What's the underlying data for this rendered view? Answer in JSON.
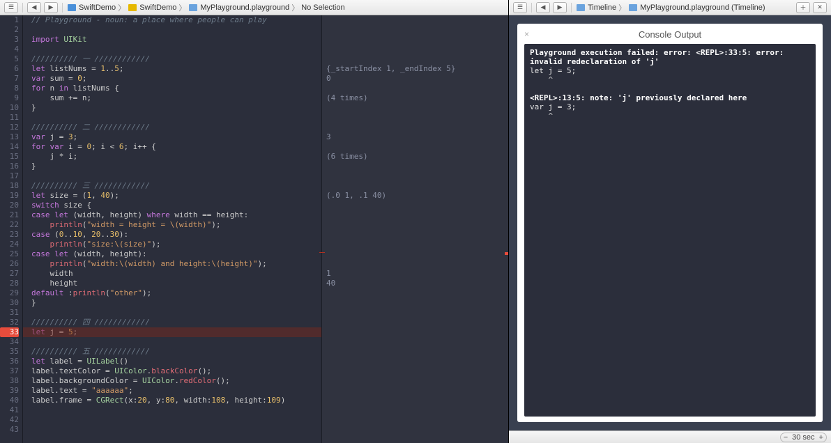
{
  "toolbar_left": {
    "crumbs": [
      {
        "icon": "swift",
        "label": "SwiftDemo"
      },
      {
        "icon": "folder",
        "label": "SwiftDemo"
      },
      {
        "icon": "playground",
        "label": "MyPlayground.playground"
      },
      {
        "icon": "",
        "label": "No Selection"
      }
    ]
  },
  "toolbar_right": {
    "crumbs": [
      {
        "icon": "timeline",
        "label": "Timeline"
      },
      {
        "icon": "playground",
        "label": "MyPlayground.playground (Timeline)"
      }
    ]
  },
  "code_lines": [
    {
      "n": 1,
      "html": "<span class='c-comment'>// Playground - noun: a place where people can play</span>"
    },
    {
      "n": 2,
      "html": ""
    },
    {
      "n": 3,
      "html": "<span class='c-kw'>import</span> <span class='c-type'>UIKit</span>"
    },
    {
      "n": 4,
      "html": ""
    },
    {
      "n": 5,
      "html": "<span class='c-comment'>////////// 一 ////////////</span>"
    },
    {
      "n": 6,
      "html": "<span class='c-kw'>let</span> listNums = <span class='c-num'>1</span>..<span class='c-num'>5</span>;"
    },
    {
      "n": 7,
      "html": "<span class='c-kw'>var</span> sum = <span class='c-num'>0</span>;"
    },
    {
      "n": 8,
      "html": "<span class='c-kw'>for</span> n <span class='c-kw'>in</span> listNums {"
    },
    {
      "n": 9,
      "html": "    sum += n;"
    },
    {
      "n": 10,
      "html": "}"
    },
    {
      "n": 11,
      "html": ""
    },
    {
      "n": 12,
      "html": "<span class='c-comment'>////////// 二 ////////////</span>"
    },
    {
      "n": 13,
      "html": "<span class='c-kw'>var</span> j = <span class='c-num'>3</span>;"
    },
    {
      "n": 14,
      "html": "<span class='c-kw'>for</span> <span class='c-kw'>var</span> i = <span class='c-num'>0</span>; i &lt; <span class='c-num'>6</span>; i++ {"
    },
    {
      "n": 15,
      "html": "    j * i;"
    },
    {
      "n": 16,
      "html": "}"
    },
    {
      "n": 17,
      "html": ""
    },
    {
      "n": 18,
      "html": "<span class='c-comment'>////////// 三 ////////////</span>"
    },
    {
      "n": 19,
      "html": "<span class='c-kw'>let</span> size = (<span class='c-num'>1</span>, <span class='c-num'>40</span>);"
    },
    {
      "n": 20,
      "html": "<span class='c-kw'>switch</span> size {"
    },
    {
      "n": 21,
      "html": "<span class='c-kw'>case</span> <span class='c-kw'>let</span> (width, height) <span class='c-kw'>where</span> width == height:"
    },
    {
      "n": 22,
      "html": "    <span class='c-func'>println</span>(<span class='c-str'>\"width = height = \\(width)\"</span>);"
    },
    {
      "n": 23,
      "html": "<span class='c-kw'>case</span> (<span class='c-num'>0</span>..<span class='c-num'>10</span>, <span class='c-num'>20</span>..<span class='c-num'>30</span>):"
    },
    {
      "n": 24,
      "html": "    <span class='c-func'>println</span>(<span class='c-str'>\"size:\\(size)\"</span>);"
    },
    {
      "n": 25,
      "html": "<span class='c-kw'>case</span> <span class='c-kw'>let</span> (width, height):"
    },
    {
      "n": 26,
      "html": "    <span class='c-func'>println</span>(<span class='c-str'>\"width:\\(width) and height:\\(height)\"</span>);"
    },
    {
      "n": 27,
      "html": "    width"
    },
    {
      "n": 28,
      "html": "    height"
    },
    {
      "n": 29,
      "html": "<span class='c-kw'>default</span> :<span class='c-func'>println</span>(<span class='c-str'>\"other\"</span>);"
    },
    {
      "n": 30,
      "html": "}"
    },
    {
      "n": 31,
      "html": ""
    },
    {
      "n": 32,
      "html": "<span class='c-comment'>////////// 四 ////////////</span>"
    },
    {
      "n": 33,
      "html": "<span class='c-kw'>let</span> j = <span class='c-num'>5</span>;",
      "error": true,
      "error_msg": "Invalid redeclaration of 'j'"
    },
    {
      "n": 34,
      "html": ""
    },
    {
      "n": 35,
      "html": "<span class='c-comment'>////////// 五 ////////////</span>"
    },
    {
      "n": 36,
      "html": "<span class='c-kw'>let</span> label = <span class='c-type'>UILabel</span>()"
    },
    {
      "n": 37,
      "html": "label.textColor = <span class='c-type'>UIColor</span>.<span class='c-func'>blackColor</span>();"
    },
    {
      "n": 38,
      "html": "label.backgroundColor = <span class='c-type'>UIColor</span>.<span class='c-func'>redColor</span>();"
    },
    {
      "n": 39,
      "html": "label.text = <span class='c-str'>\"aaaaaa\"</span>;"
    },
    {
      "n": 40,
      "html": "label.frame = <span class='c-type'>CGRect</span>(x:<span class='c-num'>20</span>, y:<span class='c-num'>80</span>, width:<span class='c-num'>108</span>, height:<span class='c-num'>109</span>)"
    },
    {
      "n": 41,
      "html": ""
    },
    {
      "n": 42,
      "html": ""
    },
    {
      "n": 43,
      "html": ""
    }
  ],
  "results": {
    "6": "{_startIndex 1, _endIndex 5}",
    "7": "0",
    "9": "(4 times)",
    "13": "3",
    "15": "(6 times)",
    "19": "(.0 1, .1 40)",
    "27": "1",
    "28": "40"
  },
  "console": {
    "title": "Console Output",
    "body": "<b>Playground execution failed: error: &lt;REPL&gt;:33:5: error: invalid redeclaration of 'j'</b>\nlet j = 5;\n<span class='caret-line'>    ^</span>\n\n<b>&lt;REPL&gt;:13:5: note: 'j' previously declared here</b>\nvar j = 3;\n<span class='caret-line'>    ^</span>"
  },
  "bottom": {
    "value": "30 sec"
  }
}
